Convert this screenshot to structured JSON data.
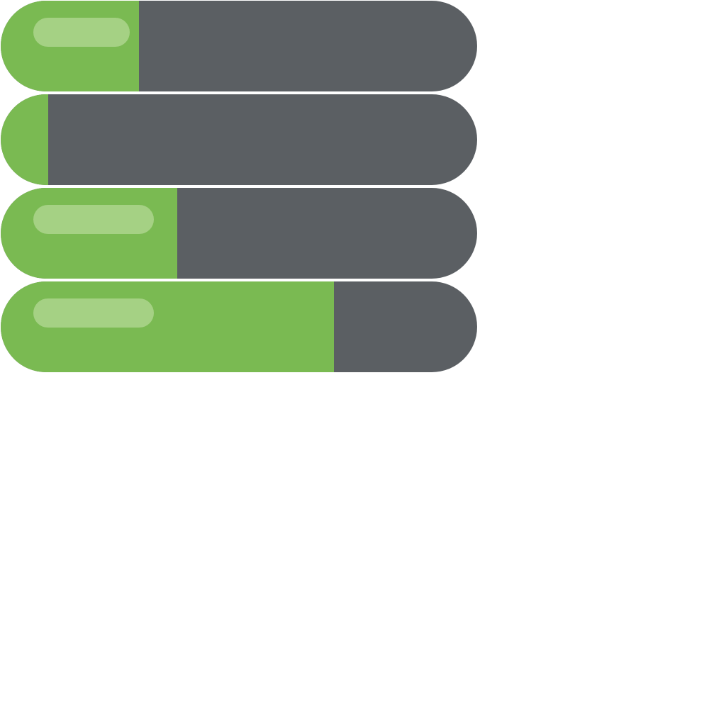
{
  "colors": {
    "track": "#5b5f63",
    "fill": "#7aba52",
    "highlight": "#c9e3ad",
    "background": "#ffffff"
  },
  "bars": [
    {
      "name": "progress-bar-1",
      "fill_fraction": 0.29,
      "has_highlight": true
    },
    {
      "name": "progress-bar-2",
      "fill_fraction": 0.1,
      "has_highlight": false
    },
    {
      "name": "progress-bar-3",
      "fill_fraction": 0.37,
      "has_highlight": true
    },
    {
      "name": "progress-bar-4",
      "fill_fraction": 0.7,
      "has_highlight": true
    }
  ]
}
